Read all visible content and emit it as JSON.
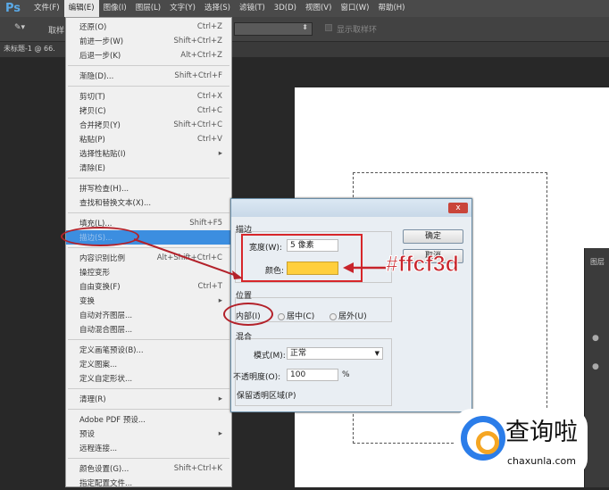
{
  "app": {
    "logo": "Ps"
  },
  "menubar": [
    "文件(F)",
    "编辑(E)",
    "图像(I)",
    "图层(L)",
    "文字(Y)",
    "选择(S)",
    "滤镜(T)",
    "3D(D)",
    "视图(V)",
    "窗口(W)",
    "帮助(H)"
  ],
  "options": {
    "tool_label": "取样",
    "show_ring": "显示取样环"
  },
  "doc_tab": "未标题-1 @ 66.",
  "edit_menu": [
    {
      "label": "还原(O)",
      "shortcut": "Ctrl+Z"
    },
    {
      "label": "前进一步(W)",
      "shortcut": "Shift+Ctrl+Z"
    },
    {
      "label": "后退一步(K)",
      "shortcut": "Alt+Ctrl+Z"
    },
    {
      "sep": true
    },
    {
      "label": "渐隐(D)...",
      "shortcut": "Shift+Ctrl+F"
    },
    {
      "sep": true
    },
    {
      "label": "剪切(T)",
      "shortcut": "Ctrl+X"
    },
    {
      "label": "拷贝(C)",
      "shortcut": "Ctrl+C"
    },
    {
      "label": "合并拷贝(Y)",
      "shortcut": "Shift+Ctrl+C"
    },
    {
      "label": "粘贴(P)",
      "shortcut": "Ctrl+V"
    },
    {
      "label": "选择性粘贴(I)",
      "shortcut": "▸"
    },
    {
      "label": "清除(E)",
      "shortcut": ""
    },
    {
      "sep": true
    },
    {
      "label": "拼写检查(H)...",
      "shortcut": ""
    },
    {
      "label": "查找和替换文本(X)...",
      "shortcut": ""
    },
    {
      "sep": true
    },
    {
      "label": "填充(L)...",
      "shortcut": "Shift+F5"
    },
    {
      "label": "描边(S)...",
      "shortcut": "",
      "highlighted": true
    },
    {
      "sep": true
    },
    {
      "label": "内容识别比例",
      "shortcut": "Alt+Shift+Ctrl+C"
    },
    {
      "label": "操控变形",
      "shortcut": ""
    },
    {
      "label": "自由变换(F)",
      "shortcut": "Ctrl+T"
    },
    {
      "label": "变换",
      "shortcut": "▸"
    },
    {
      "label": "自动对齐图层...",
      "shortcut": ""
    },
    {
      "label": "自动混合图层...",
      "shortcut": ""
    },
    {
      "sep": true
    },
    {
      "label": "定义画笔预设(B)...",
      "shortcut": ""
    },
    {
      "label": "定义图案...",
      "shortcut": ""
    },
    {
      "label": "定义自定形状...",
      "shortcut": ""
    },
    {
      "sep": true
    },
    {
      "label": "清理(R)",
      "shortcut": "▸"
    },
    {
      "sep": true
    },
    {
      "label": "Adobe PDF 预设...",
      "shortcut": ""
    },
    {
      "label": "预设",
      "shortcut": "▸"
    },
    {
      "label": "远程连接...",
      "shortcut": ""
    },
    {
      "sep": true
    },
    {
      "label": "颜色设置(G)...",
      "shortcut": "Shift+Ctrl+K"
    },
    {
      "label": "指定配置文件...",
      "shortcut": ""
    }
  ],
  "dialog": {
    "close": "x",
    "stroke_group": "描边",
    "width_label": "宽度(W):",
    "width_value": "5 像素",
    "color_label": "颜色:",
    "color": "#ffcf3d",
    "position_group": "位置",
    "inside": "内部(I)",
    "center": "居中(C)",
    "outside": "居外(U)",
    "blend_group": "混合",
    "mode_label": "模式(M):",
    "mode_value": "正常",
    "opacity_label": "不透明度(O):",
    "opacity_value": "100",
    "percent": "%",
    "preserve": "保留透明区域(P)",
    "ok": "确定",
    "cancel": "取消"
  },
  "annotation": {
    "hex": "#ffcf3d"
  },
  "layers_panel": {
    "title": "图层"
  },
  "watermark": {
    "title": "查询啦",
    "url": "chaxunla.com"
  }
}
